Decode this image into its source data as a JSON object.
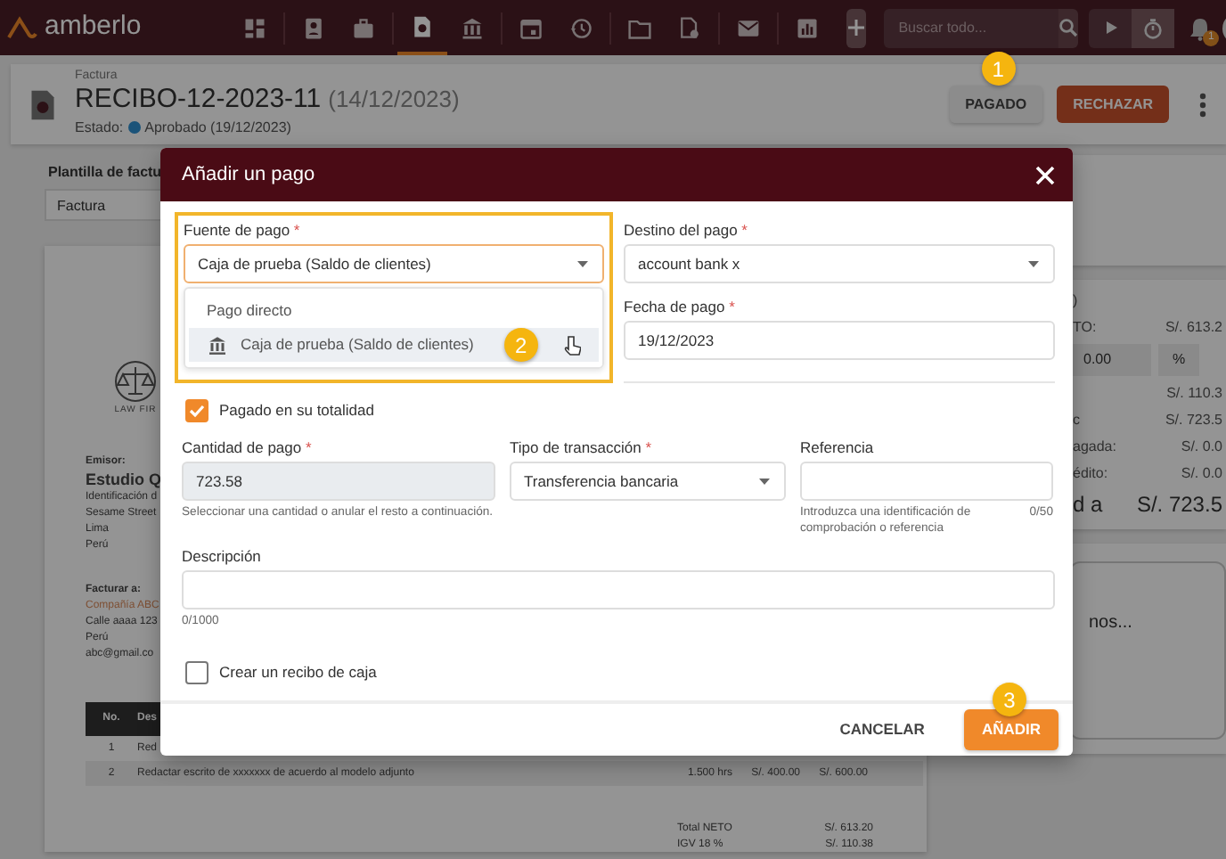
{
  "navbar": {
    "logo": "amberlo",
    "items": [
      {
        "kind": "dashboard",
        "selected": false
      },
      {
        "kind": "contacts",
        "selected": false
      },
      {
        "kind": "briefcase",
        "selected": false
      },
      {
        "kind": "invoice",
        "selected": true
      },
      {
        "kind": "bank",
        "selected": false
      },
      {
        "kind": "calendar",
        "selected": false
      },
      {
        "kind": "history",
        "selected": false
      },
      {
        "kind": "folder",
        "selected": false
      },
      {
        "kind": "document",
        "selected": false
      },
      {
        "kind": "mail",
        "selected": false
      },
      {
        "kind": "chart",
        "selected": false
      }
    ],
    "search": {
      "placeholder": "Buscar todo..."
    },
    "notifications": "1"
  },
  "header": {
    "label": "Factura",
    "title": "RECIBO-12-2023-11",
    "date": "(14/12/2023)",
    "status_label": "Estado:",
    "status": "Aprobado (19/12/2023)",
    "buttons": [
      {
        "label": "PAGADO",
        "kind": "default",
        "callout": "1"
      },
      {
        "label": "RECHAZAR",
        "kind": "danger"
      }
    ]
  },
  "template": {
    "label": "Plantilla de factu",
    "value": "Factura"
  },
  "document": {
    "logo_text": "LAW FIR",
    "issuer_label": "Emisor:",
    "issuer_name": "Estudio Q",
    "issuer_lines": [
      "Identificación d",
      "Sesame Street",
      "Lima",
      "Perú"
    ],
    "bill_to_label": "Facturar a:",
    "client": "Compañía ABC",
    "client_lines": [
      "Calle aaaa 123",
      "Perú",
      "abc@gmail.co"
    ],
    "table": {
      "columns": [
        "No.",
        "Des"
      ],
      "rows": [
        {
          "no": "1",
          "description": "Red"
        },
        {
          "no": "2",
          "description": "Redactar escrito de xxxxxxx de acuerdo al modelo adjunto",
          "quantity": "1.500 hrs",
          "rate": "S/. 400.00",
          "amount": "S/. 600.00"
        }
      ]
    },
    "totals": [
      {
        "label": "Total NETO",
        "value": "S/. 613.20"
      },
      {
        "label": "IGV 18 %",
        "value": "S/. 110.38"
      }
    ]
  },
  "summary": {
    "note": ")",
    "rows": [
      {
        "kind": "line",
        "label": "TO:",
        "value": "S/. 613.2"
      },
      {
        "kind": "discount",
        "value": "0.00",
        "unit": "%"
      },
      {
        "kind": "line",
        "value": "S/. 110.3"
      },
      {
        "kind": "line",
        "label": "c",
        "value": "S/. 723.5"
      },
      {
        "kind": "line",
        "label": "agada:",
        "value": "S/. 0.0"
      },
      {
        "kind": "line",
        "label": "édito:",
        "value": "S/. 0.0"
      },
      {
        "kind": "total",
        "label": "d a",
        "value": "S/. 723.5"
      }
    ],
    "card_text": "nos..."
  },
  "dialog": {
    "title": "Añadir un pago",
    "source": {
      "label": "Fuente de pago",
      "required_mark": "*",
      "value": "Caja de prueba (Saldo de clientes)",
      "highlighted": true,
      "options": [
        {
          "label": "Pago directo",
          "kind": "plain",
          "selected": false
        },
        {
          "label": "Caja de prueba (Saldo de clientes)",
          "kind": "bank",
          "selected": true,
          "callout": "2"
        }
      ]
    },
    "destination": {
      "label": "Destino del pago",
      "required_mark": "*",
      "value": "account bank x"
    },
    "date": {
      "label": "Fecha de pago",
      "required_mark": "*",
      "value": "19/12/2023"
    },
    "paid_in_full": {
      "label": "Pagado en su totalidad",
      "checked": true
    },
    "amount": {
      "label": "Cantidad de pago",
      "required_mark": "*",
      "value": "723.58",
      "disabled": true,
      "hint": "Seleccionar una cantidad o anular el resto a continuación."
    },
    "transaction_type": {
      "label": "Tipo de transacción",
      "required_mark": "*",
      "value": "Transferencia bancaria"
    },
    "reference": {
      "label": "Referencia",
      "hint": "Introduzca una identificación de comprobación o referencia",
      "counter": "0/50"
    },
    "description": {
      "label": "Descripción",
      "counter": "0/1000"
    },
    "cash_receipt": {
      "label": "Crear un recibo de caja",
      "checked": false
    },
    "buttons": [
      {
        "label": "CANCELAR",
        "kind": "text"
      },
      {
        "label": "AÑADIR",
        "kind": "primary",
        "callout": "3"
      }
    ]
  }
}
